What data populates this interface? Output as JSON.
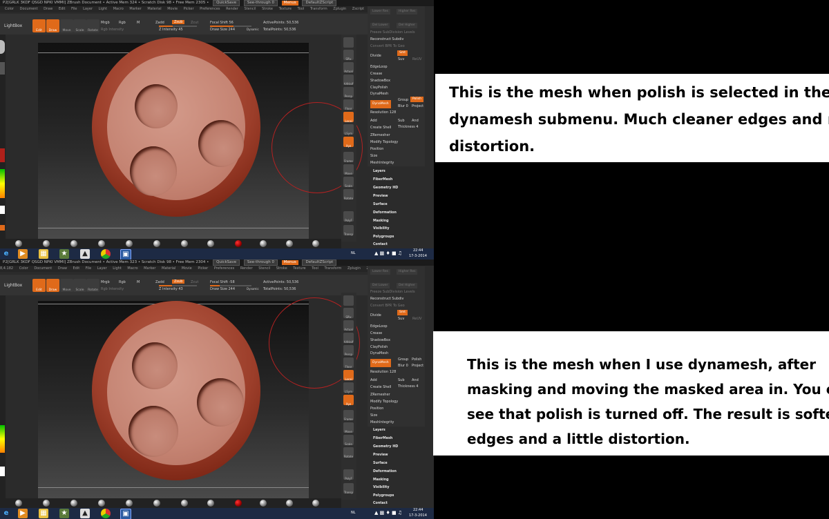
{
  "app": {
    "titlebar_text": "P2[GRLK 3KDF QSGD NPKI VMMI]   ZBrush Document   • Active Mem 324 • Scratch Disk 98 • Free Mem 2305 •",
    "titlebar_text_2": "P2[GRLK 3KDF QSGD NPKI VMMI]   ZBrush Document   • Active Mem 323 • Scratch Disk 98 • Free Mem 2304 •",
    "quicksave": "QuickSave",
    "see_through": "See-through 0",
    "menus_label": "Menus",
    "default_script": "DefaultZScript",
    "menu_items": [
      "Color",
      "Document",
      "Draw",
      "Edit",
      "File",
      "Layer",
      "Light",
      "Macro",
      "Marker",
      "Material",
      "Movie",
      "Picker",
      "Preferences",
      "Render",
      "Stencil",
      "Stroke",
      "Texture",
      "Tool",
      "Transform",
      "Zplugin",
      "Zscript"
    ]
  },
  "toolbar": {
    "lightbox": "LightBox",
    "edit": "Edit",
    "draw": "Draw",
    "move": "Move",
    "scale": "Scale",
    "rotate": "Rotate",
    "mrgb": "Mrgb",
    "rgb": "Rgb",
    "m": "M",
    "zadd": "Zadd",
    "zsub": "Zsub",
    "zcut": "Zcut",
    "rgb_intensity": "Rgb Intensity",
    "z_intensity_1": "Z Intensity 45",
    "z_intensity_2": "Z Intensity 43",
    "focal_shift_1": "Focal Shift 56",
    "focal_shift_2": "Focal Shift -58",
    "draw_size_1": "Draw Size 244",
    "draw_size_2": "Draw Size 244",
    "dynamic": "Dynamic",
    "active_points": "ActivePoints: 50,536",
    "total_points": "TotalPoints: 50,536",
    "coords": "8,4.182"
  },
  "right_panel": {
    "lower_res": "Lower Res",
    "higher_res": "Higher Res",
    "del_lower": "Del Lower",
    "del_higher": "Del Higher",
    "freeze_subdiv": "Freeze SubDivision Levels",
    "reconstruct": "Reconstruct Subdiv",
    "convert_bpr": "Convert BPR To Geo",
    "divide": "Divide",
    "smt": "Smt",
    "suv": "Suv",
    "rsuv": "ReUV",
    "edgeloop": "EdgeLoop",
    "crease": "Crease",
    "shadowbox": "ShadowBox",
    "claypolish": "ClayPolish",
    "dynamesh_header": "DynaMesh",
    "dynamesh_btn": "DynaMesh",
    "group": "Group",
    "polish": "Polish",
    "blur": "Blur 0",
    "project": "Project",
    "resolution": "Resolution 128",
    "add": "Add",
    "sub": "Sub",
    "and": "And",
    "create_shell": "Create Shell",
    "thickness": "Thickness 4",
    "zremesher": "ZRemesher",
    "modify_topology": "Modify Topology",
    "position": "Position",
    "size": "Size",
    "meshintegrity": "MeshIntegrity",
    "sections": [
      "Layers",
      "FiberMesh",
      "Geometry HD",
      "Preview",
      "Surface",
      "Deformation",
      "Masking",
      "Visibility",
      "Polygroups",
      "Contact"
    ]
  },
  "mid_icons": [
    "SPix",
    "Actual",
    "AAHalf",
    "Persp",
    "Floor",
    "Local",
    "LSym",
    "Xyz",
    "Frame",
    "Move",
    "Scale",
    "Rotate",
    "PolyF",
    "Transp"
  ],
  "taskbar": {
    "time_1": "22:44",
    "date_1": "17-3-2014",
    "time_2": "22:44",
    "date_2": "17-3-2014",
    "lang": "NL"
  },
  "notes": {
    "top_lines": [
      "This is the mesh when polish is selected in the",
      "dynamesh submenu. Much cleaner edges and no",
      "distortion."
    ],
    "bottom_lines": [
      "This is the mesh when I use dynamesh, after",
      "masking and moving the masked area in. You can",
      "see that polish is turned off. The result is softer",
      "edges and a little distortion."
    ]
  },
  "colors": {
    "accent": "#e06a1a",
    "mesh": "#9c3e2a",
    "background": "#000000",
    "note_bg": "#ffffff"
  }
}
